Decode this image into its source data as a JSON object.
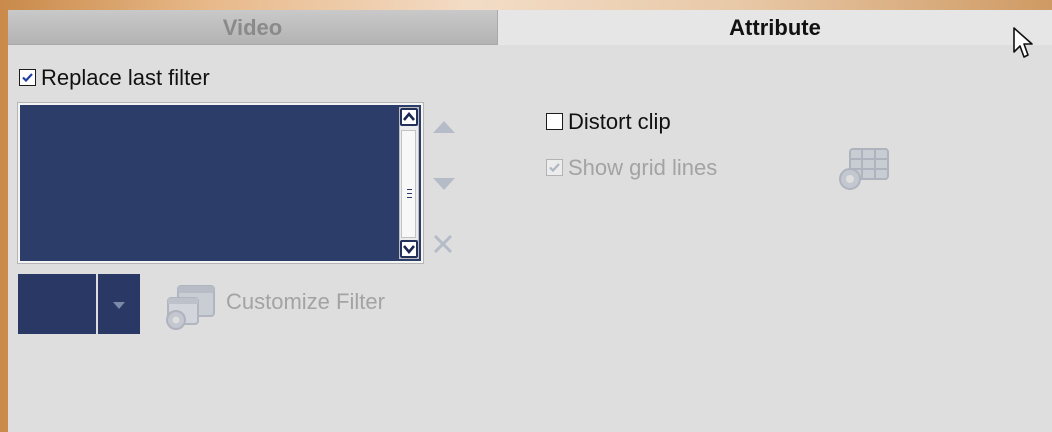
{
  "tabs": [
    {
      "label": "Video",
      "active": false
    },
    {
      "label": "Attribute",
      "active": true
    }
  ],
  "replace_last_filter": {
    "label": "Replace last filter",
    "checked": true
  },
  "filter_list": {
    "items": []
  },
  "customize_filter": {
    "label": "Customize Filter",
    "enabled": false
  },
  "distort_clip": {
    "label": "Distort clip",
    "checked": false
  },
  "show_grid_lines": {
    "label": "Show grid lines",
    "checked": true,
    "enabled": false
  },
  "icons": {
    "move_up": "triangle-up-icon",
    "move_down": "triangle-down-icon",
    "delete": "x-icon",
    "customize": "customize-filter-icon",
    "grid_settings": "grid-settings-icon",
    "cursor": "mouse-pointer-icon"
  },
  "colors": {
    "list_background": "#2d3d6a",
    "panel_background": "#dedede",
    "disabled_text": "#a3a3a3"
  }
}
